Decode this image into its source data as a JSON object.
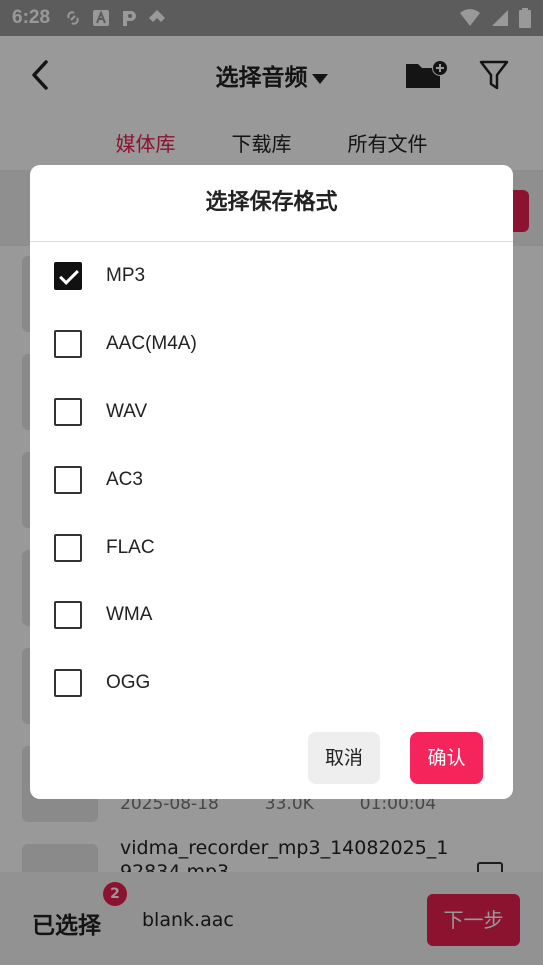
{
  "status_bar": {
    "time": "6:28"
  },
  "app_bar": {
    "title": "选择音频"
  },
  "tabs": [
    {
      "label": "媒体库",
      "active": true
    },
    {
      "label": "下载库",
      "active": false
    },
    {
      "label": "所有文件",
      "active": false
    }
  ],
  "list": {
    "partial_row": {
      "meta_date": "2025-08-18",
      "meta_size": "33.0K",
      "meta_duration": "01:00:04"
    },
    "last_row": {
      "title": "vidma_recorder_mp3_14082025_192834.mp3"
    }
  },
  "bottom_bar": {
    "selected_label": "已选择",
    "badge_count": "2",
    "selected_file": "blank.aac",
    "next_label": "下一步"
  },
  "dialog": {
    "title": "选择保存格式",
    "options": [
      {
        "label": "MP3",
        "checked": true
      },
      {
        "label": "AAC(M4A)",
        "checked": false
      },
      {
        "label": "WAV",
        "checked": false
      },
      {
        "label": "AC3",
        "checked": false
      },
      {
        "label": "FLAC",
        "checked": false
      },
      {
        "label": "WMA",
        "checked": false
      },
      {
        "label": "OGG",
        "checked": false
      }
    ],
    "cancel_label": "取消",
    "confirm_label": "确认"
  },
  "colors": {
    "accent": "#e8214f",
    "confirm": "#f5245a",
    "scrim": "rgba(0,0,0,0.4)"
  }
}
